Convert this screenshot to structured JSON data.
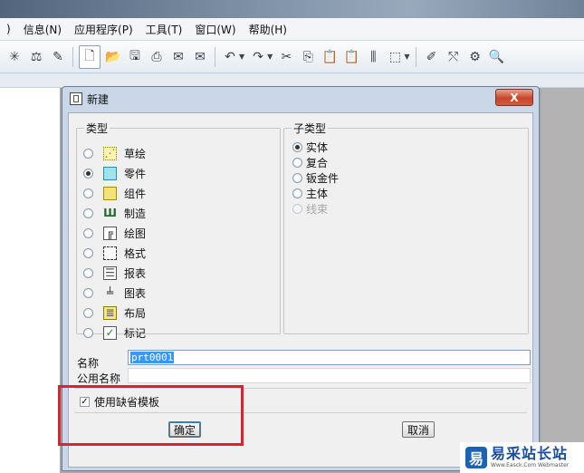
{
  "menubar": {
    "items": [
      ")",
      "信息(N)",
      "应用程序(P)",
      "工具(T)",
      "窗口(W)",
      "帮助(H)"
    ]
  },
  "toolbar": {
    "icons": [
      "pivot-icon",
      "datum-icon",
      "pencil-icon",
      "new-file-icon",
      "open-folder-icon",
      "save-icon",
      "print-icon",
      "mail-icon",
      "mail-attach-icon",
      "undo-icon",
      "redo-icon",
      "cut-icon",
      "copy-icon",
      "paste-icon",
      "paste-special-icon",
      "array-icon",
      "select-box-icon",
      "sketch-icon",
      "pattern-icon",
      "regen-icon",
      "zoom-icon"
    ]
  },
  "dialog": {
    "title": "新建",
    "close_label": "X",
    "type_legend": "类型",
    "subtype_legend": "子类型",
    "types": [
      {
        "label": "草绘",
        "icon": "sketch-icon",
        "selected": false
      },
      {
        "label": "零件",
        "icon": "part-icon",
        "selected": true
      },
      {
        "label": "组件",
        "icon": "assembly-icon",
        "selected": false
      },
      {
        "label": "制造",
        "icon": "manufacturing-icon",
        "selected": false
      },
      {
        "label": "绘图",
        "icon": "drawing-icon",
        "selected": false
      },
      {
        "label": "格式",
        "icon": "format-icon",
        "selected": false
      },
      {
        "label": "报表",
        "icon": "report-icon",
        "selected": false
      },
      {
        "label": "图表",
        "icon": "diagram-icon",
        "selected": false
      },
      {
        "label": "布局",
        "icon": "layout-icon",
        "selected": false
      },
      {
        "label": "标记",
        "icon": "markup-icon",
        "selected": false
      }
    ],
    "subtypes": [
      {
        "label": "实体",
        "selected": true,
        "enabled": true
      },
      {
        "label": "复合",
        "selected": false,
        "enabled": true
      },
      {
        "label": "钣金件",
        "selected": false,
        "enabled": true
      },
      {
        "label": "主体",
        "selected": false,
        "enabled": true
      },
      {
        "label": "线束",
        "selected": false,
        "enabled": false
      }
    ],
    "name_label": "名称",
    "name_value": "prt0001",
    "common_name_label": "公用名称",
    "common_name_value": "",
    "use_default_template_label": "使用缺省模板",
    "use_default_template_checked": true,
    "ok_label": "确定",
    "cancel_label": "取消"
  },
  "watermark": {
    "logo_char": "易",
    "text": "易采站长站",
    "subtext": "Www.Easck.Com Webmaster"
  },
  "colors": {
    "highlight_box": "#d9232e",
    "dialog_frame": "#c9d7e8",
    "selection": "#3399ff"
  }
}
